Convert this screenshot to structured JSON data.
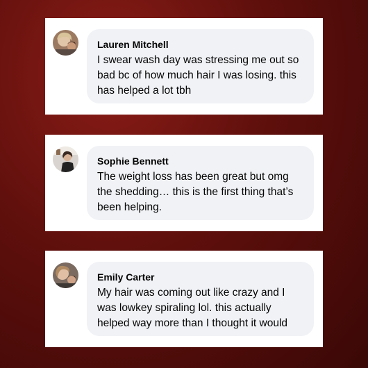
{
  "comments": [
    {
      "name": "Lauren Mitchell",
      "text": "I swear wash day was stressing me out so bad bc of how much hair I was losing. this has helped a lot tbh"
    },
    {
      "name": "Sophie Bennett",
      "text": "The weight loss has been great but omg the shedding… this is the first thing that’s been helping."
    },
    {
      "name": "Emily Carter",
      "text": "My hair was coming out like crazy and I was lowkey spiraling lol. this actually helped way more than I thought it would"
    }
  ],
  "colors": {
    "background": "#5e0f0c",
    "card": "#ffffff",
    "bubble": "#f0f2f5",
    "text": "#050505"
  }
}
